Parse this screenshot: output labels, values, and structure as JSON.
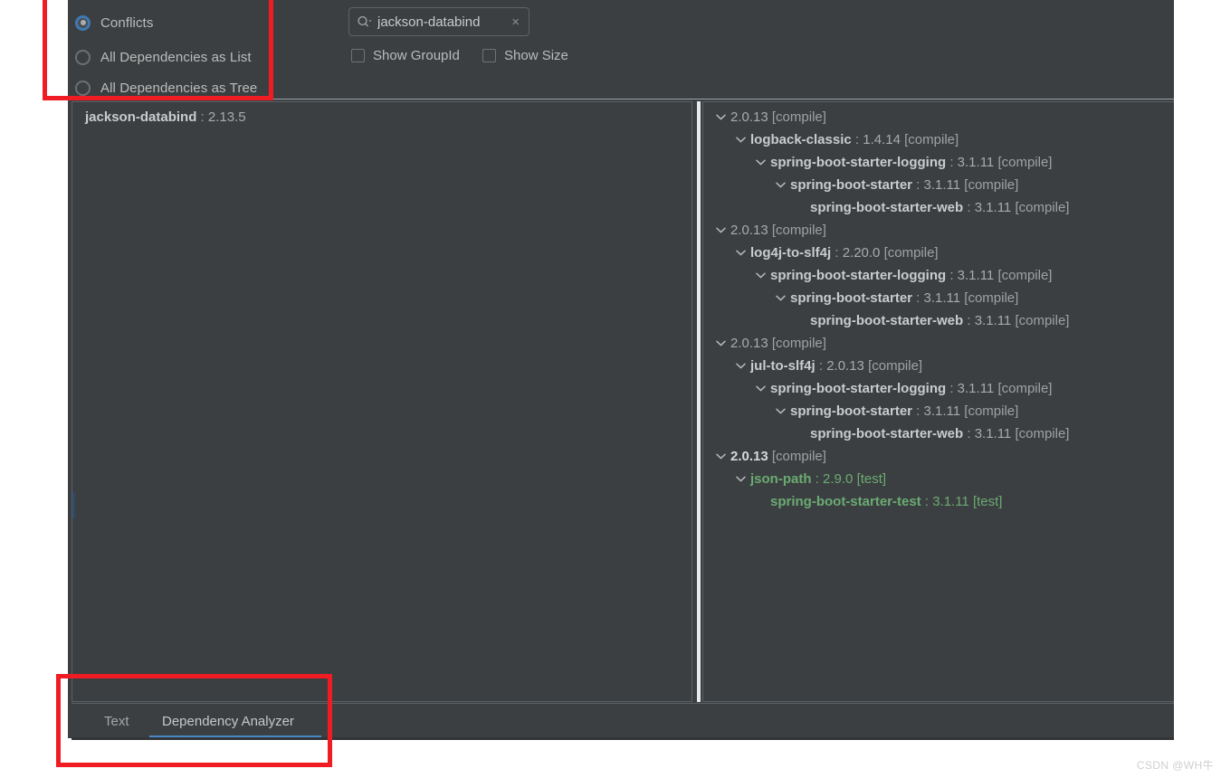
{
  "options": {
    "items": [
      {
        "label": "Conflicts",
        "selected": true
      },
      {
        "label": "All Dependencies as List",
        "selected": false
      },
      {
        "label": "All Dependencies as Tree",
        "selected": false
      }
    ]
  },
  "filter": {
    "search": {
      "value": "jackson-databind",
      "placeholder": "Search dependencies",
      "icon": "search-icon",
      "clear_icon": "×"
    },
    "checkboxes": [
      {
        "label": "Show GroupId",
        "checked": false
      },
      {
        "label": "Show Size",
        "checked": false
      }
    ]
  },
  "left_panel": {
    "item": {
      "name": "jackson-databind",
      "separator": ":",
      "version": "2.13.5"
    }
  },
  "right_panel": {
    "nodes": [
      {
        "indent": 0,
        "expandable": true,
        "scope_class": "sc-root",
        "name": "2.0.13",
        "separator": "",
        "version": "",
        "scope": "[compile]"
      },
      {
        "indent": 1,
        "expandable": true,
        "scope_class": "sc-compile",
        "name": "logback-classic",
        "separator": ":",
        "version": "1.4.14",
        "scope": "[compile]"
      },
      {
        "indent": 2,
        "expandable": true,
        "scope_class": "sc-compile",
        "name": "spring-boot-starter-logging",
        "separator": ":",
        "version": "3.1.11",
        "scope": "[compile]"
      },
      {
        "indent": 3,
        "expandable": true,
        "scope_class": "sc-compile",
        "name": "spring-boot-starter",
        "separator": ":",
        "version": "3.1.11",
        "scope": "[compile]"
      },
      {
        "indent": 4,
        "expandable": false,
        "scope_class": "sc-compile",
        "name": "spring-boot-starter-web",
        "separator": ":",
        "version": "3.1.11",
        "scope": "[compile]"
      },
      {
        "indent": 0,
        "expandable": true,
        "scope_class": "sc-root",
        "name": "2.0.13",
        "separator": "",
        "version": "",
        "scope": "[compile]"
      },
      {
        "indent": 1,
        "expandable": true,
        "scope_class": "sc-compile",
        "name": "log4j-to-slf4j",
        "separator": ":",
        "version": "2.20.0",
        "scope": "[compile]"
      },
      {
        "indent": 2,
        "expandable": true,
        "scope_class": "sc-compile",
        "name": "spring-boot-starter-logging",
        "separator": ":",
        "version": "3.1.11",
        "scope": "[compile]"
      },
      {
        "indent": 3,
        "expandable": true,
        "scope_class": "sc-compile",
        "name": "spring-boot-starter",
        "separator": ":",
        "version": "3.1.11",
        "scope": "[compile]"
      },
      {
        "indent": 4,
        "expandable": false,
        "scope_class": "sc-compile",
        "name": "spring-boot-starter-web",
        "separator": ":",
        "version": "3.1.11",
        "scope": "[compile]"
      },
      {
        "indent": 0,
        "expandable": true,
        "scope_class": "sc-root",
        "name": "2.0.13",
        "separator": "",
        "version": "",
        "scope": "[compile]"
      },
      {
        "indent": 1,
        "expandable": true,
        "scope_class": "sc-compile",
        "name": "jul-to-slf4j",
        "separator": ":",
        "version": "2.0.13",
        "scope": "[compile]"
      },
      {
        "indent": 2,
        "expandable": true,
        "scope_class": "sc-compile",
        "name": "spring-boot-starter-logging",
        "separator": ":",
        "version": "3.1.11",
        "scope": "[compile]"
      },
      {
        "indent": 3,
        "expandable": true,
        "scope_class": "sc-compile",
        "name": "spring-boot-starter",
        "separator": ":",
        "version": "3.1.11",
        "scope": "[compile]"
      },
      {
        "indent": 4,
        "expandable": false,
        "scope_class": "sc-compile",
        "name": "spring-boot-starter-web",
        "separator": ":",
        "version": "3.1.11",
        "scope": "[compile]"
      },
      {
        "indent": 0,
        "expandable": true,
        "scope_class": "sc-root-bold",
        "name": "2.0.13",
        "separator": "",
        "version": "",
        "scope": "[compile]"
      },
      {
        "indent": 1,
        "expandable": true,
        "scope_class": "sc-test",
        "name": "json-path",
        "separator": ":",
        "version": "2.9.0",
        "scope": "[test]"
      },
      {
        "indent": 2,
        "expandable": false,
        "scope_class": "sc-test",
        "name": "spring-boot-starter-test",
        "separator": ":",
        "version": "3.1.11",
        "scope": "[test]"
      }
    ]
  },
  "tabs": [
    {
      "label": "Text",
      "active": false
    },
    {
      "label": "Dependency Analyzer",
      "active": true
    }
  ],
  "watermark": "CSDN @WH牛",
  "colors": {
    "background": "#3c3f41",
    "accent_blue": "#4a88c7",
    "annotation_red": "#f01c24",
    "test_green": "#6aab73",
    "text_primary": "#c9ccce",
    "text_secondary": "#9ea2a5"
  }
}
